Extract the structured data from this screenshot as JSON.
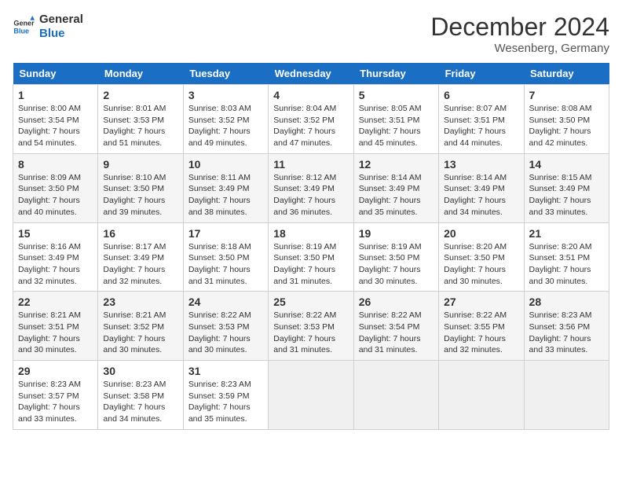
{
  "header": {
    "logo_general": "General",
    "logo_blue": "Blue",
    "month": "December 2024",
    "location": "Wesenberg, Germany"
  },
  "days_of_week": [
    "Sunday",
    "Monday",
    "Tuesday",
    "Wednesday",
    "Thursday",
    "Friday",
    "Saturday"
  ],
  "weeks": [
    [
      {
        "day": 1,
        "lines": [
          "Sunrise: 8:00 AM",
          "Sunset: 3:54 PM",
          "Daylight: 7 hours",
          "and 54 minutes."
        ]
      },
      {
        "day": 2,
        "lines": [
          "Sunrise: 8:01 AM",
          "Sunset: 3:53 PM",
          "Daylight: 7 hours",
          "and 51 minutes."
        ]
      },
      {
        "day": 3,
        "lines": [
          "Sunrise: 8:03 AM",
          "Sunset: 3:52 PM",
          "Daylight: 7 hours",
          "and 49 minutes."
        ]
      },
      {
        "day": 4,
        "lines": [
          "Sunrise: 8:04 AM",
          "Sunset: 3:52 PM",
          "Daylight: 7 hours",
          "and 47 minutes."
        ]
      },
      {
        "day": 5,
        "lines": [
          "Sunrise: 8:05 AM",
          "Sunset: 3:51 PM",
          "Daylight: 7 hours",
          "and 45 minutes."
        ]
      },
      {
        "day": 6,
        "lines": [
          "Sunrise: 8:07 AM",
          "Sunset: 3:51 PM",
          "Daylight: 7 hours",
          "and 44 minutes."
        ]
      },
      {
        "day": 7,
        "lines": [
          "Sunrise: 8:08 AM",
          "Sunset: 3:50 PM",
          "Daylight: 7 hours",
          "and 42 minutes."
        ]
      }
    ],
    [
      {
        "day": 8,
        "lines": [
          "Sunrise: 8:09 AM",
          "Sunset: 3:50 PM",
          "Daylight: 7 hours",
          "and 40 minutes."
        ]
      },
      {
        "day": 9,
        "lines": [
          "Sunrise: 8:10 AM",
          "Sunset: 3:50 PM",
          "Daylight: 7 hours",
          "and 39 minutes."
        ]
      },
      {
        "day": 10,
        "lines": [
          "Sunrise: 8:11 AM",
          "Sunset: 3:49 PM",
          "Daylight: 7 hours",
          "and 38 minutes."
        ]
      },
      {
        "day": 11,
        "lines": [
          "Sunrise: 8:12 AM",
          "Sunset: 3:49 PM",
          "Daylight: 7 hours",
          "and 36 minutes."
        ]
      },
      {
        "day": 12,
        "lines": [
          "Sunrise: 8:14 AM",
          "Sunset: 3:49 PM",
          "Daylight: 7 hours",
          "and 35 minutes."
        ]
      },
      {
        "day": 13,
        "lines": [
          "Sunrise: 8:14 AM",
          "Sunset: 3:49 PM",
          "Daylight: 7 hours",
          "and 34 minutes."
        ]
      },
      {
        "day": 14,
        "lines": [
          "Sunrise: 8:15 AM",
          "Sunset: 3:49 PM",
          "Daylight: 7 hours",
          "and 33 minutes."
        ]
      }
    ],
    [
      {
        "day": 15,
        "lines": [
          "Sunrise: 8:16 AM",
          "Sunset: 3:49 PM",
          "Daylight: 7 hours",
          "and 32 minutes."
        ]
      },
      {
        "day": 16,
        "lines": [
          "Sunrise: 8:17 AM",
          "Sunset: 3:49 PM",
          "Daylight: 7 hours",
          "and 32 minutes."
        ]
      },
      {
        "day": 17,
        "lines": [
          "Sunrise: 8:18 AM",
          "Sunset: 3:50 PM",
          "Daylight: 7 hours",
          "and 31 minutes."
        ]
      },
      {
        "day": 18,
        "lines": [
          "Sunrise: 8:19 AM",
          "Sunset: 3:50 PM",
          "Daylight: 7 hours",
          "and 31 minutes."
        ]
      },
      {
        "day": 19,
        "lines": [
          "Sunrise: 8:19 AM",
          "Sunset: 3:50 PM",
          "Daylight: 7 hours",
          "and 30 minutes."
        ]
      },
      {
        "day": 20,
        "lines": [
          "Sunrise: 8:20 AM",
          "Sunset: 3:50 PM",
          "Daylight: 7 hours",
          "and 30 minutes."
        ]
      },
      {
        "day": 21,
        "lines": [
          "Sunrise: 8:20 AM",
          "Sunset: 3:51 PM",
          "Daylight: 7 hours",
          "and 30 minutes."
        ]
      }
    ],
    [
      {
        "day": 22,
        "lines": [
          "Sunrise: 8:21 AM",
          "Sunset: 3:51 PM",
          "Daylight: 7 hours",
          "and 30 minutes."
        ]
      },
      {
        "day": 23,
        "lines": [
          "Sunrise: 8:21 AM",
          "Sunset: 3:52 PM",
          "Daylight: 7 hours",
          "and 30 minutes."
        ]
      },
      {
        "day": 24,
        "lines": [
          "Sunrise: 8:22 AM",
          "Sunset: 3:53 PM",
          "Daylight: 7 hours",
          "and 30 minutes."
        ]
      },
      {
        "day": 25,
        "lines": [
          "Sunrise: 8:22 AM",
          "Sunset: 3:53 PM",
          "Daylight: 7 hours",
          "and 31 minutes."
        ]
      },
      {
        "day": 26,
        "lines": [
          "Sunrise: 8:22 AM",
          "Sunset: 3:54 PM",
          "Daylight: 7 hours",
          "and 31 minutes."
        ]
      },
      {
        "day": 27,
        "lines": [
          "Sunrise: 8:22 AM",
          "Sunset: 3:55 PM",
          "Daylight: 7 hours",
          "and 32 minutes."
        ]
      },
      {
        "day": 28,
        "lines": [
          "Sunrise: 8:23 AM",
          "Sunset: 3:56 PM",
          "Daylight: 7 hours",
          "and 33 minutes."
        ]
      }
    ],
    [
      {
        "day": 29,
        "lines": [
          "Sunrise: 8:23 AM",
          "Sunset: 3:57 PM",
          "Daylight: 7 hours",
          "and 33 minutes."
        ]
      },
      {
        "day": 30,
        "lines": [
          "Sunrise: 8:23 AM",
          "Sunset: 3:58 PM",
          "Daylight: 7 hours",
          "and 34 minutes."
        ]
      },
      {
        "day": 31,
        "lines": [
          "Sunrise: 8:23 AM",
          "Sunset: 3:59 PM",
          "Daylight: 7 hours",
          "and 35 minutes."
        ]
      },
      null,
      null,
      null,
      null
    ]
  ]
}
